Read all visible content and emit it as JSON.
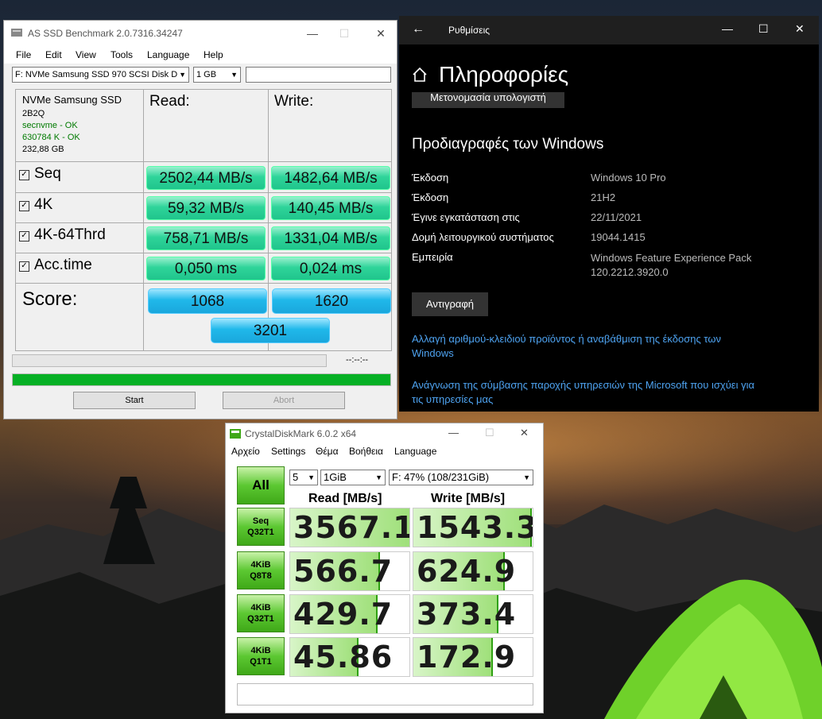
{
  "asssd": {
    "title": "AS SSD Benchmark 2.0.7316.34247",
    "menu": [
      "File",
      "Edit",
      "View",
      "Tools",
      "Language",
      "Help"
    ],
    "drive_select": "F: NVMe Samsung SSD 970 SCSI Disk D",
    "size_select": "1 GB",
    "drive_info": {
      "name": "NVMe Samsung SSD",
      "firmware": "2B2Q",
      "driver": "secnvme - OK",
      "alignment": "630784 K - OK",
      "capacity": "232,88 GB"
    },
    "read_header": "Read:",
    "write_header": "Write:",
    "rows": [
      {
        "label": "Seq",
        "read": "2502,44 MB/s",
        "write": "1482,64 MB/s"
      },
      {
        "label": "4K",
        "read": "59,32 MB/s",
        "write": "140,45 MB/s"
      },
      {
        "label": "4K-64Thrd",
        "read": "758,71 MB/s",
        "write": "1331,04 MB/s"
      },
      {
        "label": "Acc.time",
        "read": "0,050 ms",
        "write": "0,024 ms"
      }
    ],
    "score_label": "Score:",
    "score_read": "1068",
    "score_write": "1620",
    "score_total": "3201",
    "time": "--:--:--",
    "progress": 1.0,
    "start_label": "Start",
    "abort_label": "Abort"
  },
  "settings": {
    "title": "Ρυθμίσεις",
    "heading": "Πληροφορίες",
    "rename_button": "Μετονομασία υπολογιστή",
    "section_title": "Προδιαγραφές των Windows",
    "specs": [
      {
        "label": "Έκδοση",
        "value": "Windows 10 Pro"
      },
      {
        "label": "Έκδοση",
        "value": "21H2"
      },
      {
        "label": "Έγινε εγκατάσταση στις",
        "value": "22/11/2021"
      },
      {
        "label": "Δομή λειτουργικού συστήματος",
        "value": "19044.1415"
      },
      {
        "label": "Εμπειρία",
        "value": "Windows Feature Experience Pack 120.2212.3920.0"
      }
    ],
    "copy_button": "Αντιγραφή",
    "link1": "Αλλαγή αριθμού-κλειδιού προϊόντος ή αναβάθμιση της έκδοσης των Windows",
    "link2": "Ανάγνωση της σύμβασης παροχής υπηρεσιών της Microsoft που ισχύει για τις υπηρεσίες μας"
  },
  "cdm": {
    "title": "CrystalDiskMark 6.0.2 x64",
    "menu": [
      "Αρχείο",
      "Settings",
      "Θέμα",
      "Βοήθεια",
      "Language"
    ],
    "all_label": "All",
    "count_select": "5",
    "size_select": "1GiB",
    "drive_select": "F: 47% (108/231GiB)",
    "read_header": "Read [MB/s]",
    "write_header": "Write [MB/s]",
    "rows": [
      {
        "line1": "Seq",
        "line2": "Q32T1",
        "read": "3567.1",
        "write": "1543.3",
        "read_fill": 1.0,
        "write_fill": 0.98
      },
      {
        "line1": "4KiB",
        "line2": "Q8T8",
        "read": "566.7",
        "write": "624.9",
        "read_fill": 0.74,
        "write_fill": 0.75
      },
      {
        "line1": "4KiB",
        "line2": "Q32T1",
        "read": "429.7",
        "write": "373.4",
        "read_fill": 0.72,
        "write_fill": 0.7
      },
      {
        "line1": "4KiB",
        "line2": "Q1T1",
        "read": "45.86",
        "write": "172.9",
        "read_fill": 0.56,
        "write_fill": 0.65
      }
    ]
  }
}
